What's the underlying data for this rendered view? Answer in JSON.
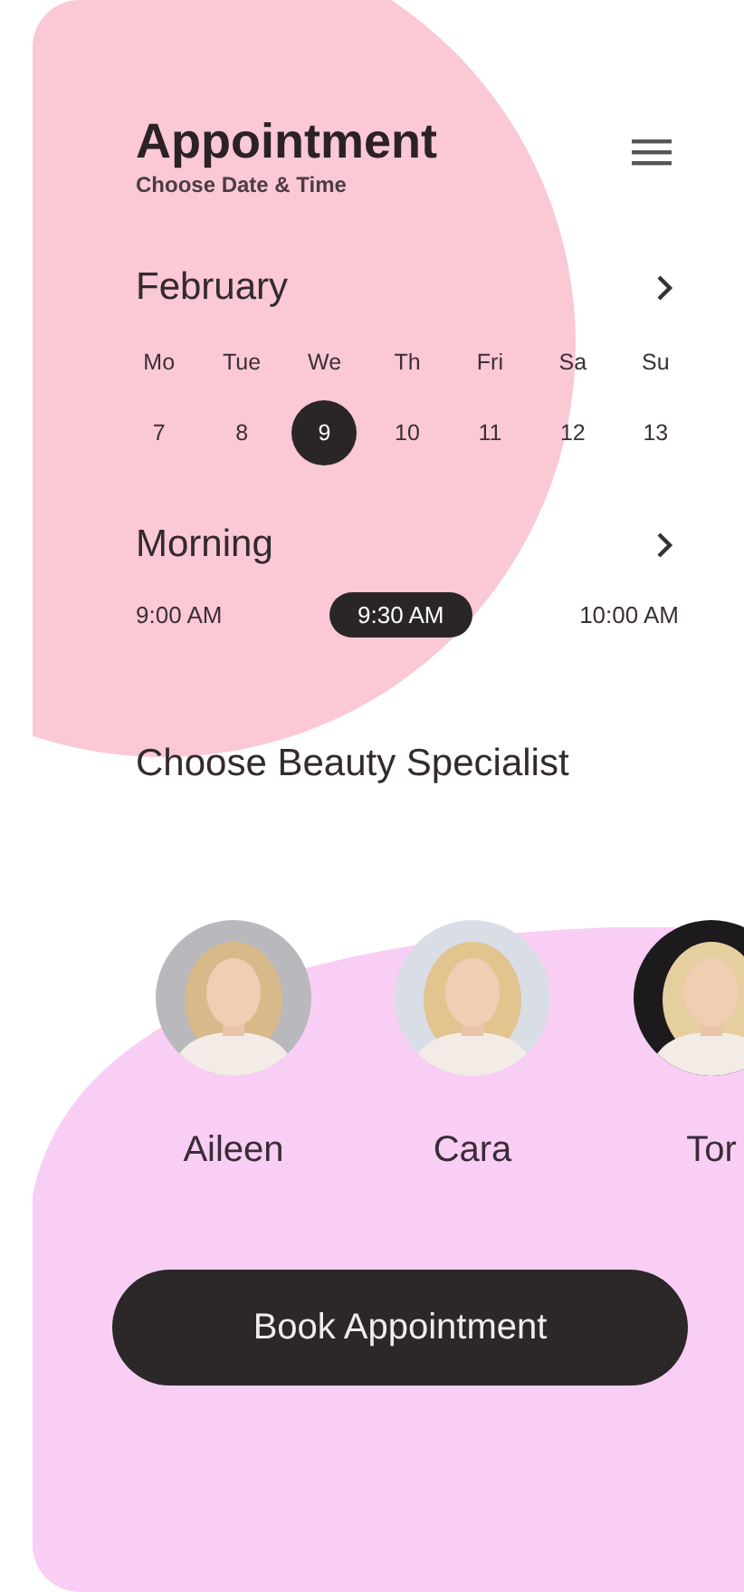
{
  "header": {
    "title": "Appointment",
    "subtitle": "Choose Date & Time"
  },
  "month": {
    "label": "February"
  },
  "weekdays": [
    "Mo",
    "Tue",
    "We",
    "Th",
    "Fri",
    "Sa",
    "Su"
  ],
  "dates": [
    {
      "label": "7",
      "selected": false
    },
    {
      "label": "8",
      "selected": false
    },
    {
      "label": "9",
      "selected": true
    },
    {
      "label": "10",
      "selected": false
    },
    {
      "label": "11",
      "selected": false
    },
    {
      "label": "12",
      "selected": false
    },
    {
      "label": "13",
      "selected": false
    }
  ],
  "period": {
    "label": "Morning"
  },
  "times": [
    {
      "label": "9:00 AM",
      "selected": false
    },
    {
      "label": "9:30 AM",
      "selected": true
    },
    {
      "label": "10:00 AM",
      "selected": false
    }
  ],
  "specialists_heading": "Choose Beauty Specialist",
  "specialists": [
    {
      "name": "Aileen"
    },
    {
      "name": "Cara"
    },
    {
      "name": "Tor"
    }
  ],
  "book_button": "Book Appointment"
}
